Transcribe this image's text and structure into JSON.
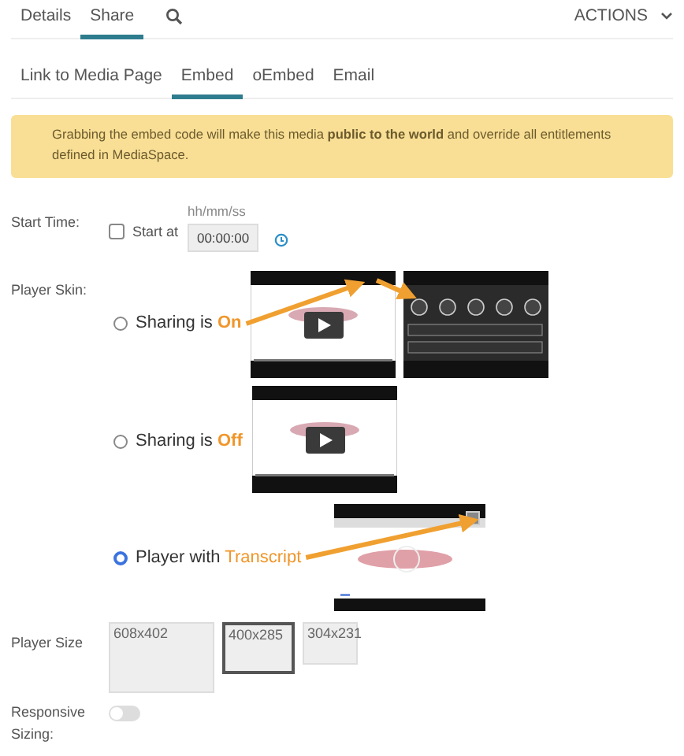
{
  "tabs": [
    {
      "label": "Details",
      "selected": false
    },
    {
      "label": "Share",
      "selected": true
    }
  ],
  "actions": {
    "label": "ACTIONS"
  },
  "subtabs": [
    {
      "label": "Link to Media Page",
      "selected": false
    },
    {
      "label": "Embed",
      "selected": true
    },
    {
      "label": "oEmbed",
      "selected": false
    },
    {
      "label": "Email",
      "selected": false
    }
  ],
  "alert": "Grabbing the embed code will make this media **public to the world** and override all entitlements defined in MediaSpace.",
  "start_time": {
    "label": "Start Time:",
    "checkbox": {
      "label": "Start at",
      "checked": false
    },
    "hint": "hh/mm/ss",
    "value": "00:00:00"
  },
  "player_skin": {
    "label": "Player Skin:",
    "options": [
      {
        "text": "Sharing is",
        "highlight": "On",
        "selected": false,
        "previews": [
          {
            "kind": "player"
          },
          {
            "kind": "share-panel"
          }
        ]
      },
      {
        "text": "Sharing is",
        "highlight": "Off",
        "selected": false,
        "previews": [
          {
            "kind": "player"
          }
        ]
      },
      {
        "text": "Player with",
        "highlight": "Transcript",
        "selected": true,
        "previews": [
          {
            "kind": "transcript"
          }
        ]
      }
    ]
  },
  "player_size": {
    "label": "Player Size",
    "options": [
      {
        "label": "608x402",
        "selected": false
      },
      {
        "label": "400x285",
        "selected": true
      },
      {
        "label": "304x231",
        "selected": false
      }
    ]
  },
  "responsive": {
    "label": "Responsive Sizing:",
    "on": false
  }
}
